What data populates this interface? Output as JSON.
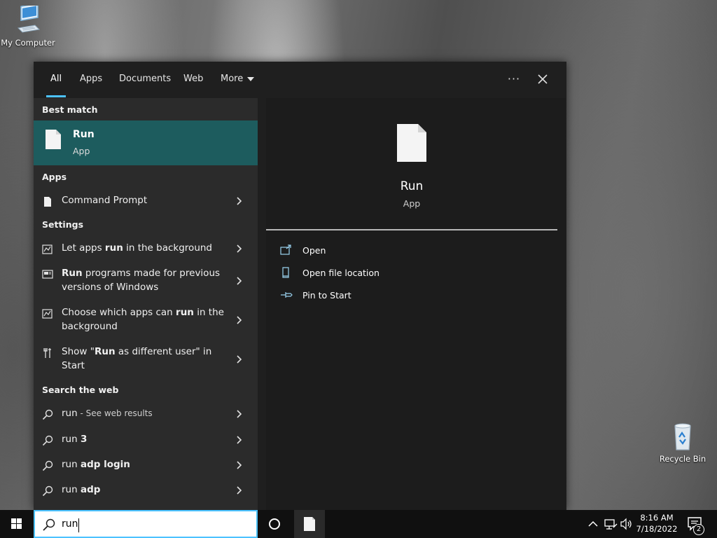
{
  "desktop": {
    "icons": [
      {
        "label": "My Computer"
      },
      {
        "label": "Recycle Bin"
      }
    ]
  },
  "search": {
    "tabs": [
      {
        "label": "All"
      },
      {
        "label": "Apps"
      },
      {
        "label": "Documents"
      },
      {
        "label": "Web"
      },
      {
        "label": "More"
      }
    ],
    "more_options_label": "···",
    "close_label": "✕",
    "best_match": {
      "section": "Best match",
      "name": "Run",
      "type": "App"
    },
    "apps": {
      "section": "Apps",
      "items": [
        {
          "label": "Command Prompt"
        }
      ]
    },
    "settings": {
      "section": "Settings",
      "items": [
        {
          "pre": "Let apps ",
          "bold": "run",
          "post": " in the background"
        },
        {
          "pre": "",
          "bold": "Run",
          "post": " programs made for previous versions of Windows"
        },
        {
          "pre": "Choose which apps can ",
          "bold": "run",
          "post": " in the background"
        },
        {
          "pre": "Show \"",
          "bold": "Run",
          "post": " as different user\" in Start"
        }
      ]
    },
    "web": {
      "section": "Search the web",
      "items": [
        {
          "term": "run",
          "bold": "",
          "suffix": " - See web results"
        },
        {
          "term": "run ",
          "bold": "3",
          "suffix": ""
        },
        {
          "term": "run ",
          "bold": "adp login",
          "suffix": ""
        },
        {
          "term": "run ",
          "bold": "adp",
          "suffix": ""
        }
      ]
    },
    "preview": {
      "name": "Run",
      "type": "App",
      "actions": [
        {
          "label": "Open"
        },
        {
          "label": "Open file location"
        },
        {
          "label": "Pin to Start"
        }
      ]
    },
    "query": "run"
  },
  "taskbar": {
    "time": "8:16 AM",
    "date": "7/18/2022",
    "notification_count": "2"
  },
  "colors": {
    "accent": "#4cc2ff",
    "selected_bg": "#1d5c5e"
  }
}
